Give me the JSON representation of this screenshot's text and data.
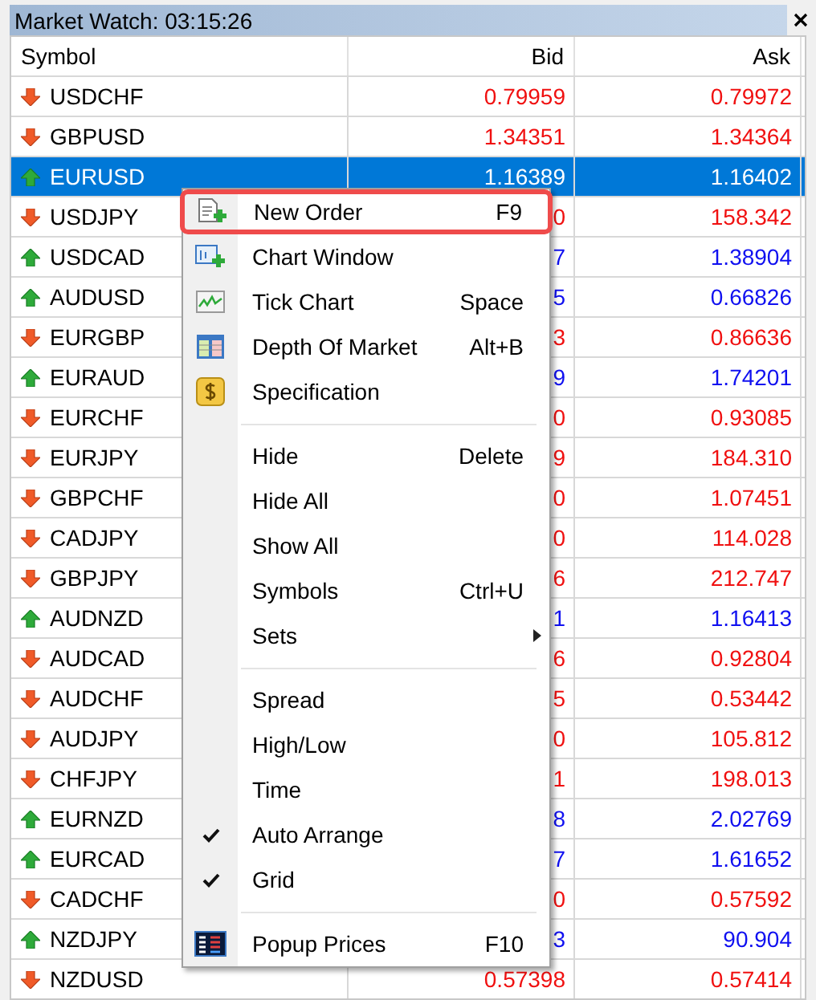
{
  "window": {
    "title": "Market Watch: 03:15:26"
  },
  "table": {
    "columns": [
      "Symbol",
      "Bid",
      "Ask"
    ],
    "rows": [
      {
        "symbol": "USDCHF",
        "up": false,
        "bid": "0.79959",
        "ask": "0.79972",
        "selected": false
      },
      {
        "symbol": "GBPUSD",
        "up": false,
        "bid": "1.34351",
        "ask": "1.34364",
        "selected": false
      },
      {
        "symbol": "EURUSD",
        "up": true,
        "bid": "1.16389",
        "ask": "1.16402",
        "selected": true
      },
      {
        "symbol": "USDJPY",
        "up": false,
        "bid": "0",
        "ask": "158.342",
        "selected": false
      },
      {
        "symbol": "USDCAD",
        "up": true,
        "bid": "7",
        "ask": "1.38904",
        "selected": false
      },
      {
        "symbol": "AUDUSD",
        "up": true,
        "bid": "5",
        "ask": "0.66826",
        "selected": false
      },
      {
        "symbol": "EURGBP",
        "up": false,
        "bid": "3",
        "ask": "0.86636",
        "selected": false
      },
      {
        "symbol": "EURAUD",
        "up": true,
        "bid": "9",
        "ask": "1.74201",
        "selected": false
      },
      {
        "symbol": "EURCHF",
        "up": false,
        "bid": "0",
        "ask": "0.93085",
        "selected": false
      },
      {
        "symbol": "EURJPY",
        "up": false,
        "bid": "9",
        "ask": "184.310",
        "selected": false
      },
      {
        "symbol": "GBPCHF",
        "up": false,
        "bid": "0",
        "ask": "1.07451",
        "selected": false
      },
      {
        "symbol": "CADJPY",
        "up": false,
        "bid": "0",
        "ask": "114.028",
        "selected": false
      },
      {
        "symbol": "GBPJPY",
        "up": false,
        "bid": "6",
        "ask": "212.747",
        "selected": false
      },
      {
        "symbol": "AUDNZD",
        "up": true,
        "bid": "1",
        "ask": "1.16413",
        "selected": false
      },
      {
        "symbol": "AUDCAD",
        "up": false,
        "bid": "6",
        "ask": "0.92804",
        "selected": false
      },
      {
        "symbol": "AUDCHF",
        "up": false,
        "bid": "5",
        "ask": "0.53442",
        "selected": false
      },
      {
        "symbol": "AUDJPY",
        "up": false,
        "bid": "0",
        "ask": "105.812",
        "selected": false
      },
      {
        "symbol": "CHFJPY",
        "up": false,
        "bid": "1",
        "ask": "198.013",
        "selected": false
      },
      {
        "symbol": "EURNZD",
        "up": true,
        "bid": "8",
        "ask": "2.02769",
        "selected": false
      },
      {
        "symbol": "EURCAD",
        "up": true,
        "bid": "7",
        "ask": "1.61652",
        "selected": false
      },
      {
        "symbol": "CADCHF",
        "up": false,
        "bid": "0",
        "ask": "0.57592",
        "selected": false
      },
      {
        "symbol": "NZDJPY",
        "up": true,
        "bid": "3",
        "ask": "90.904",
        "selected": false
      },
      {
        "symbol": "NZDUSD",
        "up": false,
        "bid": "0.57398",
        "ask": "0.57414",
        "selected": false
      }
    ]
  },
  "context_menu": {
    "items": [
      {
        "kind": "item",
        "label": "New Order",
        "shortcut": "F9",
        "checked": false,
        "submenu": false,
        "selected": true
      },
      {
        "kind": "item",
        "label": "Chart Window",
        "checked": false,
        "submenu": false,
        "selected": false
      },
      {
        "kind": "item",
        "label": "Tick Chart",
        "shortcut": "Space",
        "checked": false,
        "submenu": false,
        "selected": false
      },
      {
        "kind": "item",
        "label": "Depth Of Market",
        "shortcut": "Alt+B",
        "checked": false,
        "submenu": false,
        "selected": false
      },
      {
        "kind": "item",
        "label": "Specification",
        "checked": false,
        "submenu": false,
        "selected": false
      },
      {
        "kind": "separator"
      },
      {
        "kind": "item",
        "label": "Hide",
        "shortcut": "Delete",
        "checked": false,
        "submenu": false,
        "selected": false
      },
      {
        "kind": "item",
        "label": "Hide All",
        "checked": false,
        "submenu": false,
        "selected": false
      },
      {
        "kind": "item",
        "label": "Show All",
        "checked": false,
        "submenu": false,
        "selected": false
      },
      {
        "kind": "item",
        "label": "Symbols",
        "shortcut": "Ctrl+U",
        "checked": false,
        "submenu": false,
        "selected": false
      },
      {
        "kind": "item",
        "label": "Sets",
        "checked": false,
        "submenu": true,
        "selected": false
      },
      {
        "kind": "separator"
      },
      {
        "kind": "item",
        "label": "Spread",
        "checked": false,
        "submenu": false,
        "selected": false
      },
      {
        "kind": "item",
        "label": "High/Low",
        "checked": false,
        "submenu": false,
        "selected": false
      },
      {
        "kind": "item",
        "label": "Time",
        "checked": false,
        "submenu": false,
        "selected": false
      },
      {
        "kind": "item",
        "label": "Auto Arrange",
        "checked": true,
        "submenu": false,
        "selected": false
      },
      {
        "kind": "item",
        "label": "Grid",
        "checked": true,
        "submenu": false,
        "selected": false
      },
      {
        "kind": "separator"
      },
      {
        "kind": "item",
        "label": "Popup Prices",
        "shortcut": "F10",
        "checked": false,
        "submenu": false,
        "selected": false
      }
    ]
  }
}
